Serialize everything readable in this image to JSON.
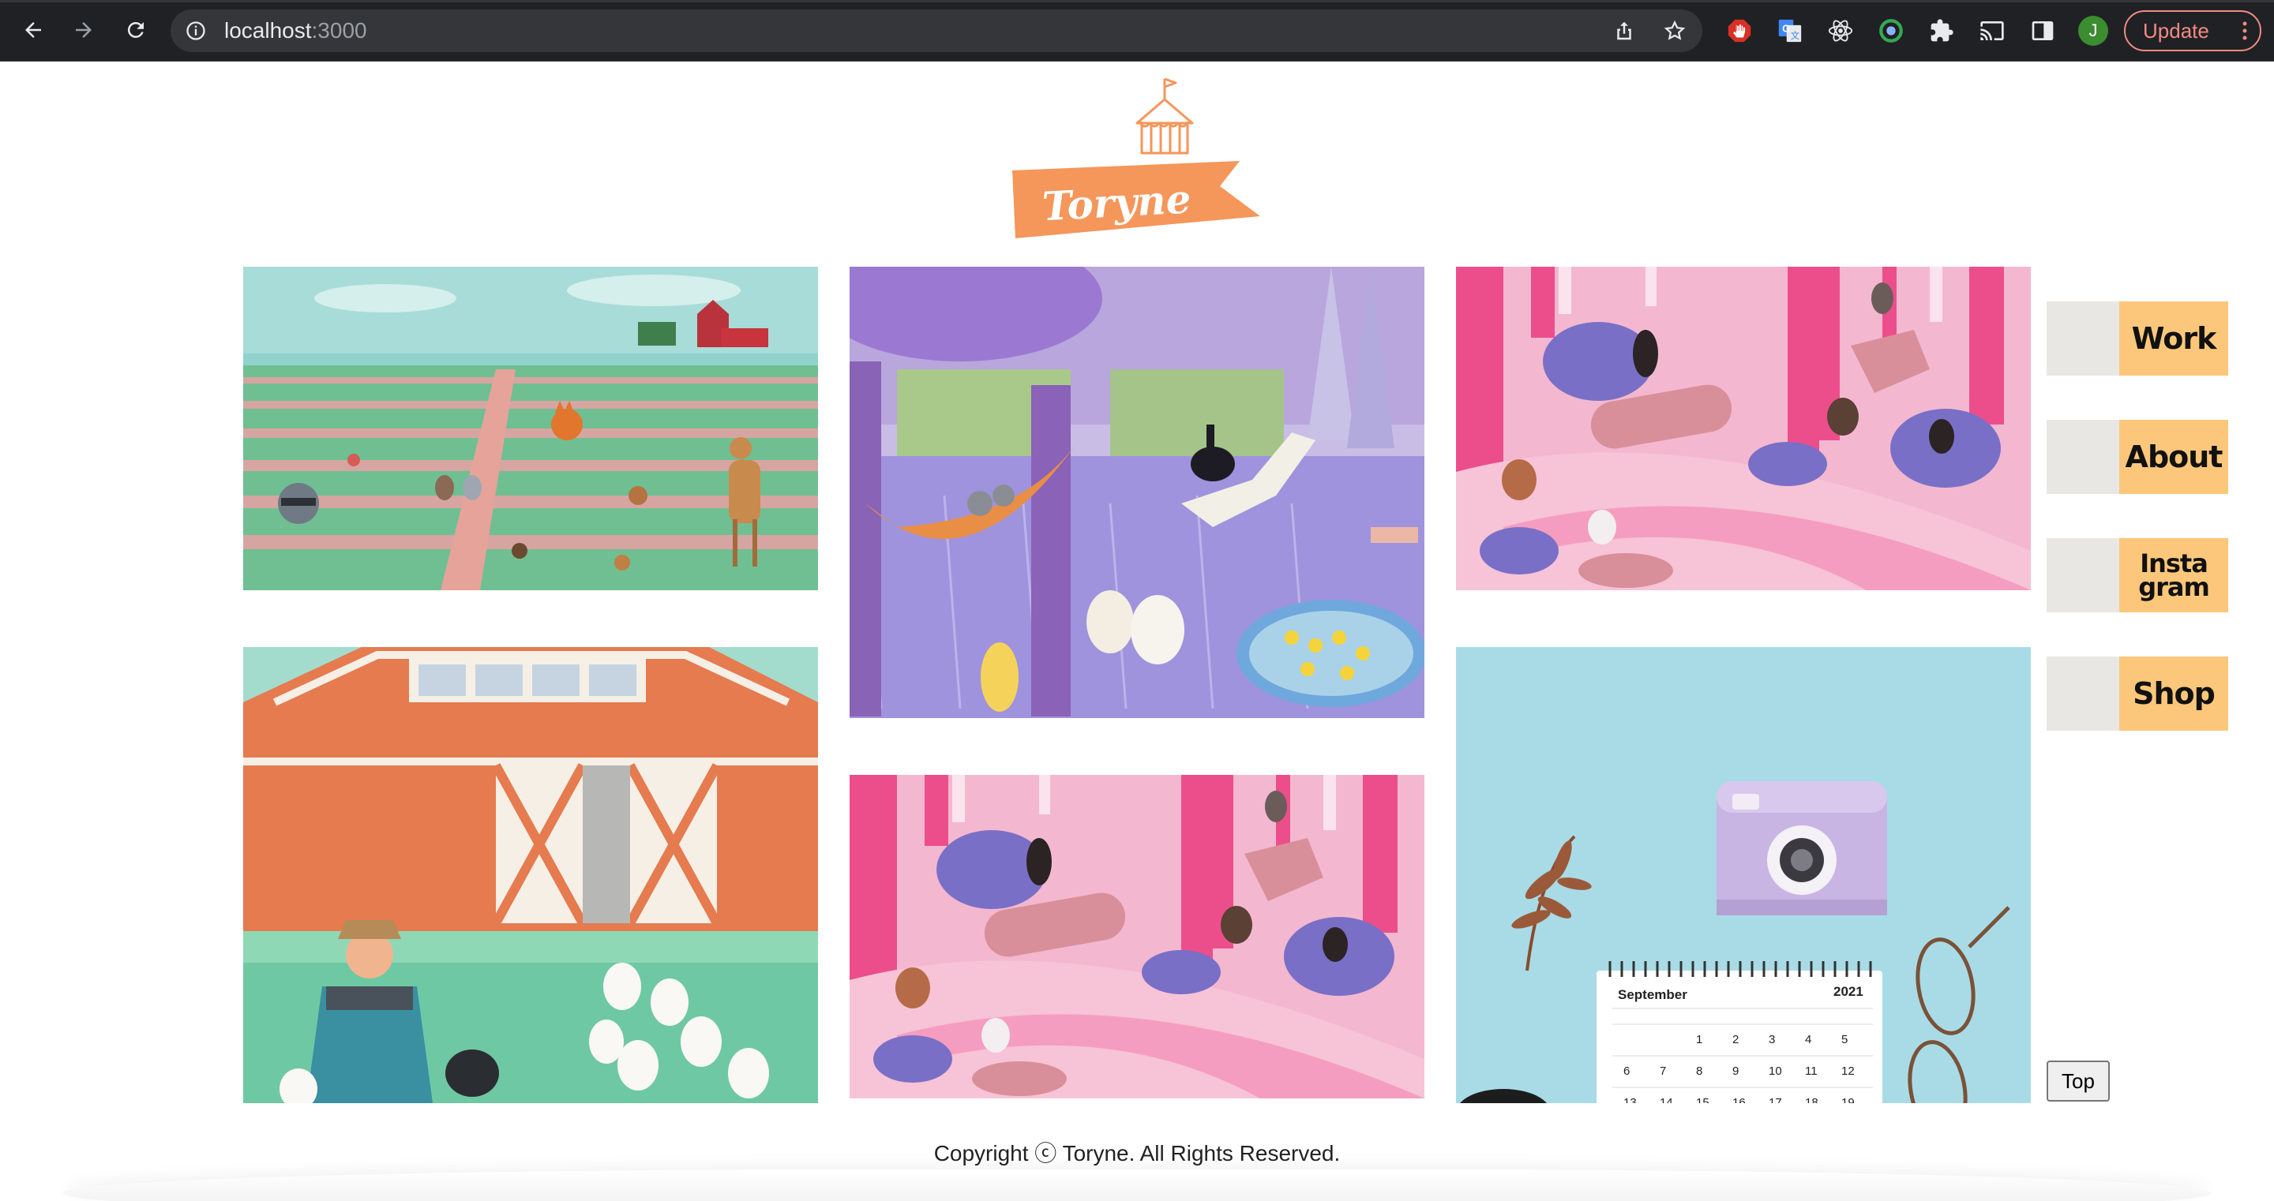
{
  "browser": {
    "url_host": "localhost",
    "url_port": ":3000",
    "profile_initial": "J",
    "update_label": "Update"
  },
  "site": {
    "logo_text": "Toryne"
  },
  "nav": {
    "work": "Work",
    "about": "About",
    "instagram": "Insta\ngram",
    "shop": "Shop"
  },
  "gallery": {
    "calendar_month": "September",
    "calendar_year": "2021",
    "calendar_days": [
      "1",
      "2",
      "3",
      "4",
      "5",
      "6",
      "7",
      "8",
      "9",
      "10",
      "11",
      "12",
      "13",
      "14",
      "15",
      "16",
      "17",
      "18",
      "19"
    ]
  },
  "top_button": "Top",
  "footer": {
    "copyright": "Copyright ⓒ Toryne. All Rights Reserved."
  },
  "colors": {
    "brand_orange": "#f5965a",
    "nav_tab": "#fcc77a",
    "nav_bg": "#e8e7e4",
    "chrome_bg": "#202124"
  }
}
